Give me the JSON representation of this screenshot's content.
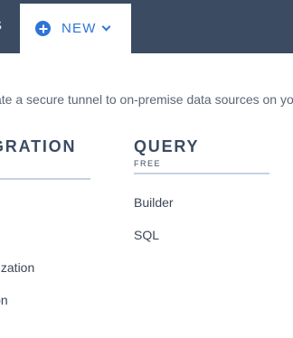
{
  "topbar": {
    "prev_tab_label": "S",
    "new_tab_label": "NEW"
  },
  "subtitle": "ate a secure tunnel to on-premise data sources on you",
  "integration": {
    "heading": "GRATION",
    "items": [
      "nization",
      "ion"
    ]
  },
  "query": {
    "heading": "QUERY",
    "badge": "FREE",
    "items": [
      "Builder",
      "SQL"
    ]
  },
  "colors": {
    "topbar_bg": "#3b4b62",
    "accent": "#2f73d6",
    "divider": "#c5d2e4"
  },
  "icons": [
    "plus-circle-icon",
    "chevron-down-icon"
  ]
}
